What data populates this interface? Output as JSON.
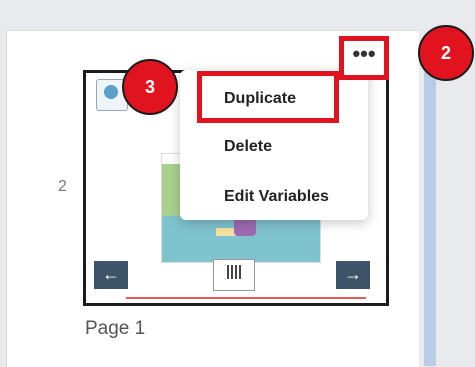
{
  "page_list": {
    "page_number": "2",
    "page_label": "Page 1"
  },
  "thumbnail": {
    "back_icon": "arrow-left-icon",
    "next_icon": "arrow-right-icon",
    "back_glyph": "←",
    "next_glyph": "→"
  },
  "more_button": {
    "label": "•••"
  },
  "context_menu": {
    "items": [
      {
        "label": "Duplicate"
      },
      {
        "label": "Delete"
      },
      {
        "label": "Edit Variables"
      }
    ]
  },
  "callouts": {
    "badge_2": "2",
    "badge_3": "3",
    "color": "#e1131f"
  }
}
